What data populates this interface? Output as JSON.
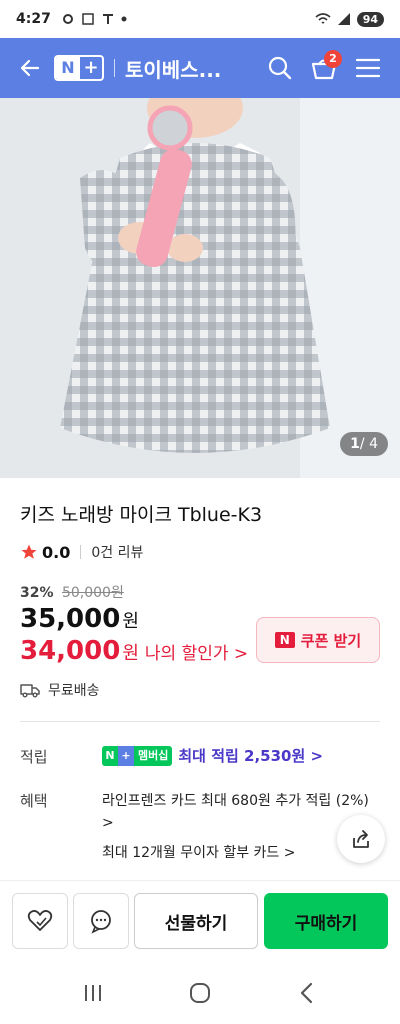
{
  "status": {
    "time": "4:27",
    "battery": "94"
  },
  "header": {
    "store_name": "토이베스...",
    "cart_count": "2",
    "logo_n": "N",
    "logo_plus": "+"
  },
  "gallery": {
    "current": "1",
    "total": "/ 4"
  },
  "product": {
    "title": "키즈 노래방 마이크 Tblue-K3",
    "rating": "0.0",
    "reviews": "0건 리뷰",
    "discount_pct": "32%",
    "original_price": "50,000원",
    "price": "35,000",
    "my_price": "34,000",
    "currency": "원",
    "my_price_label": "나의 할인가 >",
    "shipping": "무료배송"
  },
  "coupon": {
    "badge": "N",
    "label": "쿠폰 받기"
  },
  "points": {
    "label": "적립",
    "badge_n": "N",
    "badge_plus": "+",
    "badge_text": "멤버십",
    "value": "최대 적립 2,530원 >"
  },
  "benefits": {
    "label": "혜택",
    "line1": "라인프렌즈 카드 최대 680원 추가 적립 (2%) >",
    "line2": "최대 12개월 무이자 할부 카드 >"
  },
  "actions": {
    "gift": "선물하기",
    "buy": "구매하기"
  },
  "colors": {
    "header": "#5b7fe3",
    "accent_red": "#e31d3b",
    "buy_green": "#03c75a",
    "points_purple": "#4a38c8"
  }
}
